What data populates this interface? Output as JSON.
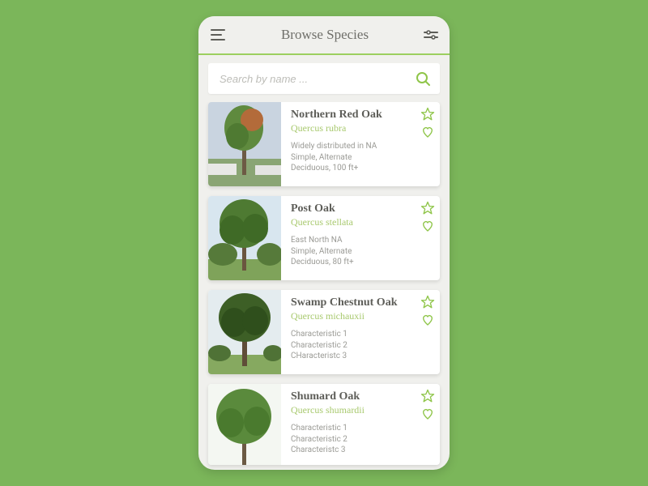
{
  "header": {
    "title": "Browse Species"
  },
  "search": {
    "placeholder": "Search by name ..."
  },
  "accent": "#8fc549",
  "species": [
    {
      "name": "Northern Red Oak",
      "latin": "Quercus rubra",
      "char1": "Widely distributed in NA",
      "char2": "Simple, Alternate",
      "char3": "Deciduous, 100 ft+"
    },
    {
      "name": "Post Oak",
      "latin": "Quercus stellata",
      "char1": "East North NA",
      "char2": "Simple, Alternate",
      "char3": "Deciduous, 80 ft+"
    },
    {
      "name": "Swamp Chestnut Oak",
      "latin": "Quercus michauxii",
      "char1": "Characteristic 1",
      "char2": "Characteristic 2",
      "char3": "CHaracteristc 3"
    },
    {
      "name": "Shumard Oak",
      "latin": "Quercus shumardii",
      "char1": "Characteristic 1",
      "char2": "Characteristic 2",
      "char3": "Characteristc 3"
    }
  ]
}
